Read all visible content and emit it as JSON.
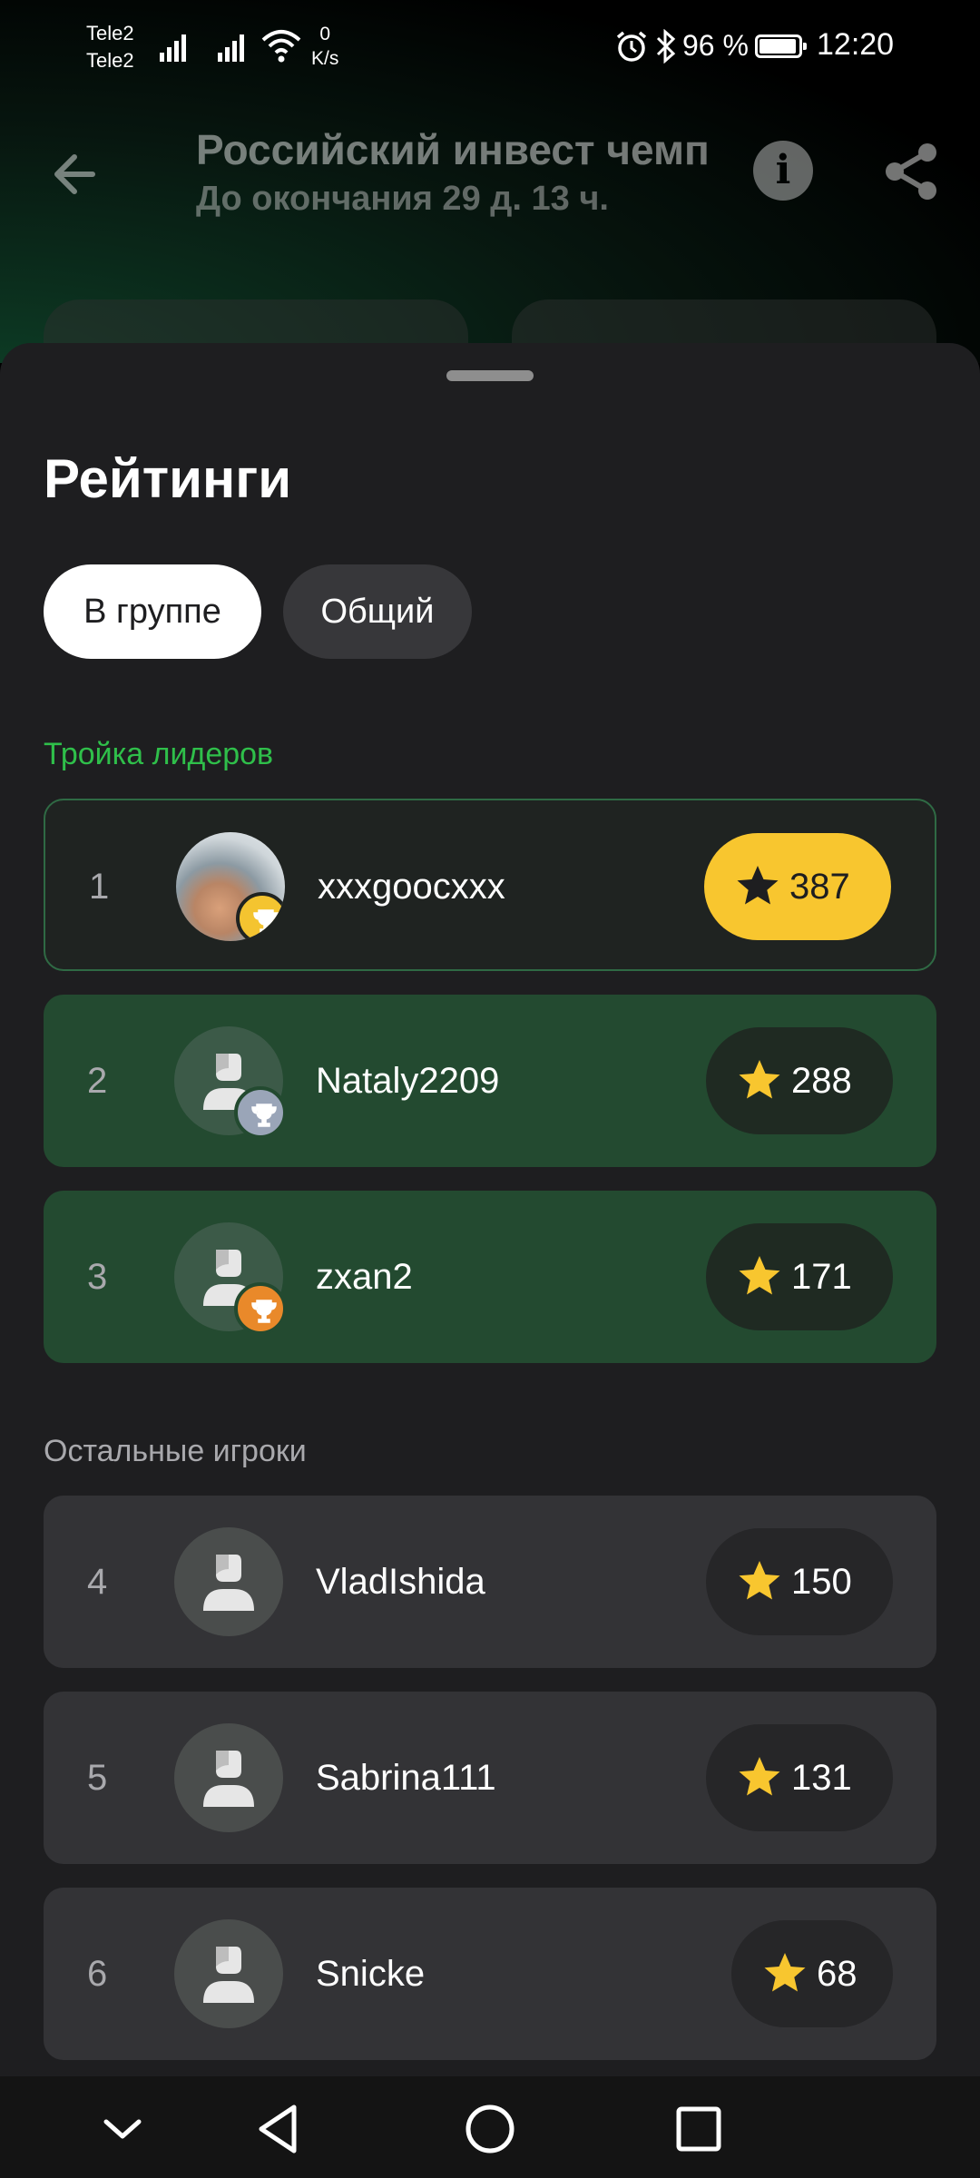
{
  "status_bar": {
    "carrier_1": "Tele2",
    "carrier_2": "Tele2",
    "speed_value": "0",
    "speed_unit": "K/s",
    "battery": "96 %",
    "time": "12:20"
  },
  "header": {
    "title": "Российский инвест чемп",
    "subtitle": "До окончания 29 д. 13 ч."
  },
  "sheet": {
    "title": "Рейтинги",
    "tabs": [
      {
        "label": "В группе",
        "selected": true
      },
      {
        "label": "Общий",
        "selected": false
      }
    ],
    "leaders_label": "Тройка лидеров",
    "others_label": "Остальные игроки",
    "leaders": [
      {
        "rank": "1",
        "name": "xxxgoocxxx",
        "score": "387",
        "badge": "gold-trophy"
      },
      {
        "rank": "2",
        "name": "Nataly2209",
        "score": "288",
        "badge": "silver-trophy"
      },
      {
        "rank": "3",
        "name": "zxan2",
        "score": "171",
        "badge": "bronze-trophy"
      }
    ],
    "others": [
      {
        "rank": "4",
        "name": "VladIshida",
        "score": "150"
      },
      {
        "rank": "5",
        "name": "Sabrina111",
        "score": "131"
      },
      {
        "rank": "6",
        "name": "Snicke",
        "score": "68"
      }
    ]
  },
  "colors": {
    "accent_green": "#2fbf4a",
    "gold": "#f8c62f",
    "leader_row_green": "#234a30"
  }
}
